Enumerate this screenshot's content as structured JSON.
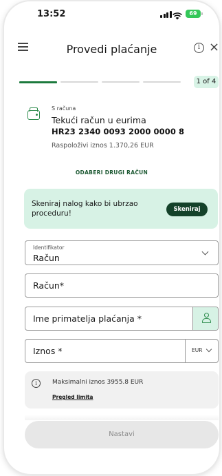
{
  "status_bar": {
    "time": "13:52",
    "battery": "69"
  },
  "header": {
    "title": "Provedi plaćanje",
    "close_glyph": "×",
    "info_glyph": "i",
    "icons": [
      "menu-icon",
      "info-icon",
      "close-icon"
    ]
  },
  "progress": {
    "step_label": "1 of 4",
    "current_step": 1,
    "total_steps": 4,
    "active_color": "#1c7a3d"
  },
  "account": {
    "source_label": "S računa",
    "name": "Tekući račun u eurima",
    "iban": "HR23 2340 0093 2000 0000 8",
    "balance": "Raspoloživi iznos 1.370,26 EUR",
    "change_link": "ODABERI DRUGI RAČUN"
  },
  "scan_banner": {
    "text": "Skeniraj nalog kako bi ubrzao proceduru!",
    "button": "Skeniraj",
    "background": "#d7f2e5",
    "button_color": "#14422a"
  },
  "form": {
    "identifier": {
      "label": "Identifikator",
      "value": "Račun"
    },
    "account_field": {
      "label": "Račun*"
    },
    "recipient_field": {
      "label": "Ime primatelja plaćanja *"
    },
    "amount_field": {
      "label": "Iznos *",
      "currency": "EUR"
    }
  },
  "limit_info": {
    "text": "Maksimalni iznos 3955.8 EUR",
    "link": "Pregled limita",
    "info_glyph": "i"
  },
  "continue_button": {
    "label": "Nastavi"
  }
}
